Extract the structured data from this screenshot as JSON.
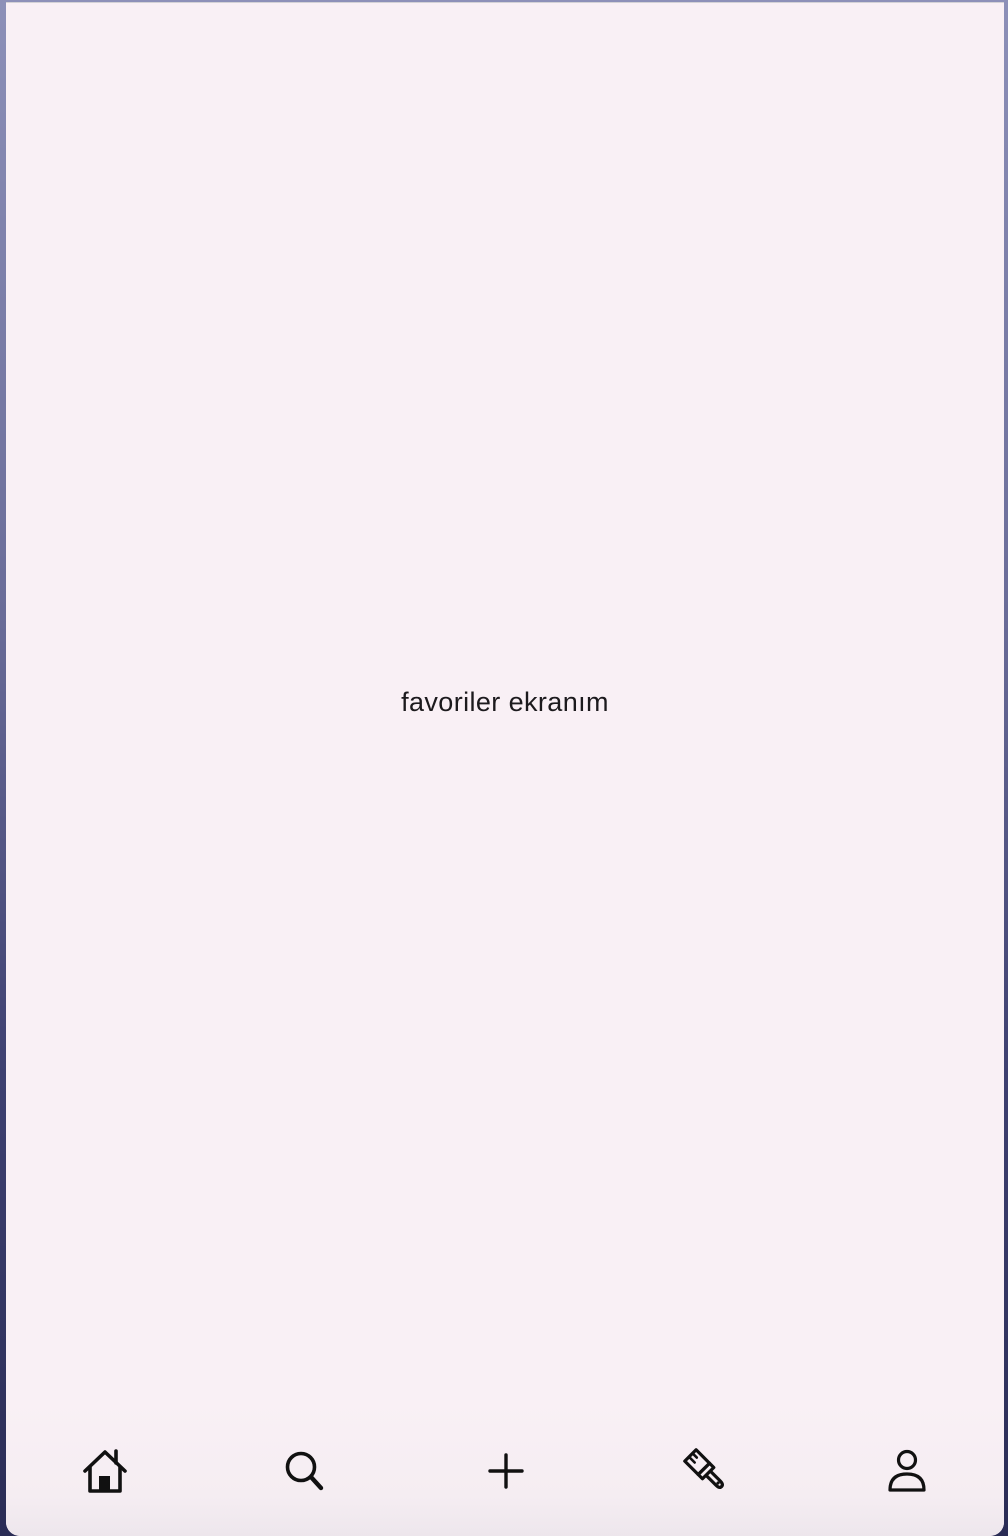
{
  "main": {
    "text": "favoriler ekranım"
  },
  "bottom_nav": {
    "items": [
      {
        "icon": "home-icon"
      },
      {
        "icon": "search-icon"
      },
      {
        "icon": "plus-icon"
      },
      {
        "icon": "brush-icon"
      },
      {
        "icon": "person-icon"
      }
    ]
  },
  "colors": {
    "background": "#f9f0f5",
    "text": "#1c1a1d",
    "icon": "#111111"
  }
}
